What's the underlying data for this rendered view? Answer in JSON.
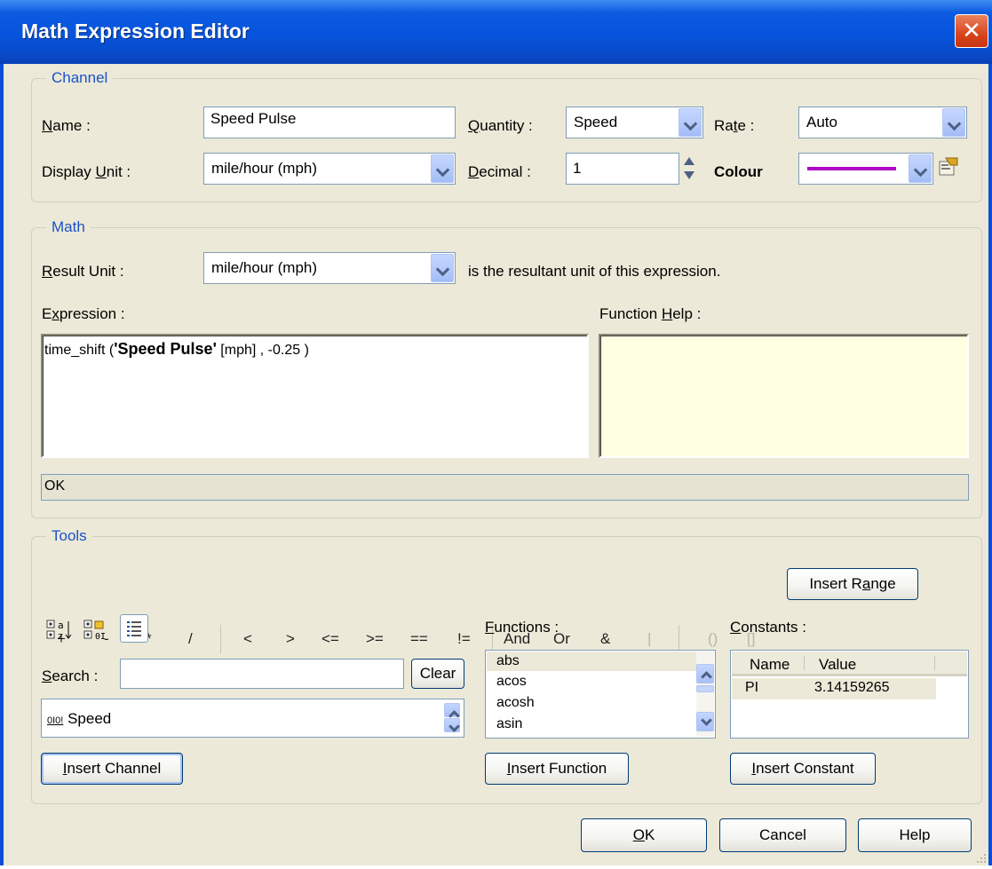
{
  "window": {
    "title": "Math Expression Editor"
  },
  "channel": {
    "legend": "Channel",
    "name_label": "Name :",
    "name_value": "Speed Pulse",
    "quantity_label": "Quantity :",
    "quantity_value": "Speed",
    "rate_label": "Rate :",
    "rate_value": "Auto",
    "display_unit_label": "Display Unit :",
    "display_unit_value": "mile/hour (mph)",
    "decimal_label": "Decimal :",
    "decimal_value": "1",
    "colour_label": "Colour",
    "colour_value": "#b000c8"
  },
  "math": {
    "legend": "Math",
    "result_unit_label": "Result Unit :",
    "result_unit_value": "mile/hour (mph)",
    "result_unit_note": "is the resultant unit of this expression.",
    "expression_label": "Expression :",
    "expression_prefix": "time_shift (",
    "expression_channel": "'Speed Pulse'",
    "expression_suffix": " [mph] , -0.25 )",
    "function_help_label": "Function Help :",
    "status": "OK"
  },
  "tools": {
    "legend": "Tools",
    "operators": [
      "+",
      "-",
      "*",
      "/",
      "<",
      ">",
      "<=",
      ">=",
      "==",
      "!=",
      "And",
      "Or",
      "&",
      "|",
      "()",
      "[]"
    ],
    "insert_range": "Insert Range",
    "search_label": "Search :",
    "search_value": "",
    "clear_button": "Clear",
    "channel_item": "Speed",
    "channel_item_icon": "0I0!",
    "insert_channel": "Insert Channel",
    "functions_label": "Functions :",
    "functions": [
      "abs",
      "acos",
      "acosh",
      "asin"
    ],
    "insert_function": "Insert Function",
    "constants_label": "Constants :",
    "constants_columns": [
      "Name",
      "Value"
    ],
    "constants_rows": [
      {
        "name": "PI",
        "value": "3.14159265"
      }
    ],
    "insert_constant": "Insert Constant"
  },
  "footer": {
    "ok": "OK",
    "cancel": "Cancel",
    "help": "Help"
  }
}
